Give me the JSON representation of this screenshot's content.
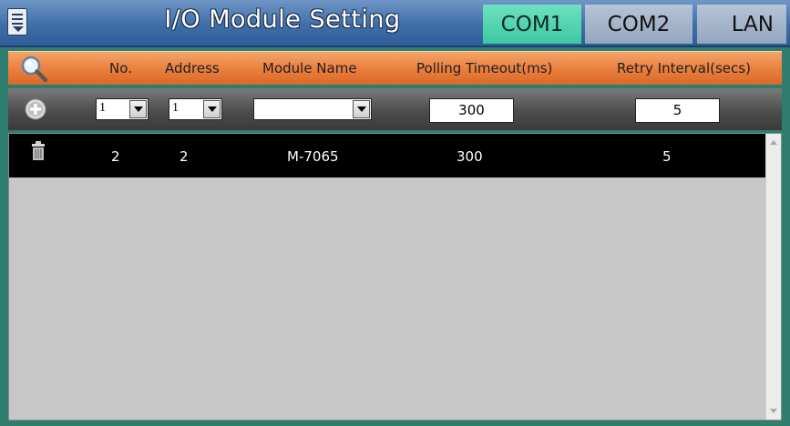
{
  "header": {
    "title": "I/O Module Setting",
    "tabs": [
      {
        "label": "COM1",
        "active": true
      },
      {
        "label": "COM2",
        "active": false
      },
      {
        "label": "LAN",
        "active": false
      }
    ]
  },
  "columns": {
    "no": "No.",
    "address": "Address",
    "module_name": "Module Name",
    "polling_timeout": "Polling Timeout(ms)",
    "retry_interval": "Retry Interval(secs)"
  },
  "inputs": {
    "no_value": "1",
    "address_value": "1",
    "module_name_value": "",
    "polling_timeout_value": "300",
    "retry_interval_value": "5"
  },
  "rows": [
    {
      "no": "2",
      "address": "2",
      "module_name": "M-7065",
      "polling_timeout": "300",
      "retry_interval": "5"
    }
  ],
  "colors": {
    "title_bar": "#3f6fa8",
    "active_tab": "#3bc9a0",
    "inactive_tab": "#94a6be",
    "column_header": "#e77b3a",
    "input_row": "#4d4d4d",
    "row_bg": "#000000",
    "list_bg": "#c7c7c7",
    "frame": "#2e7d6e"
  },
  "icons": {
    "menu": "menu-icon",
    "search": "search-icon",
    "add": "add-icon",
    "delete": "trash-icon"
  }
}
